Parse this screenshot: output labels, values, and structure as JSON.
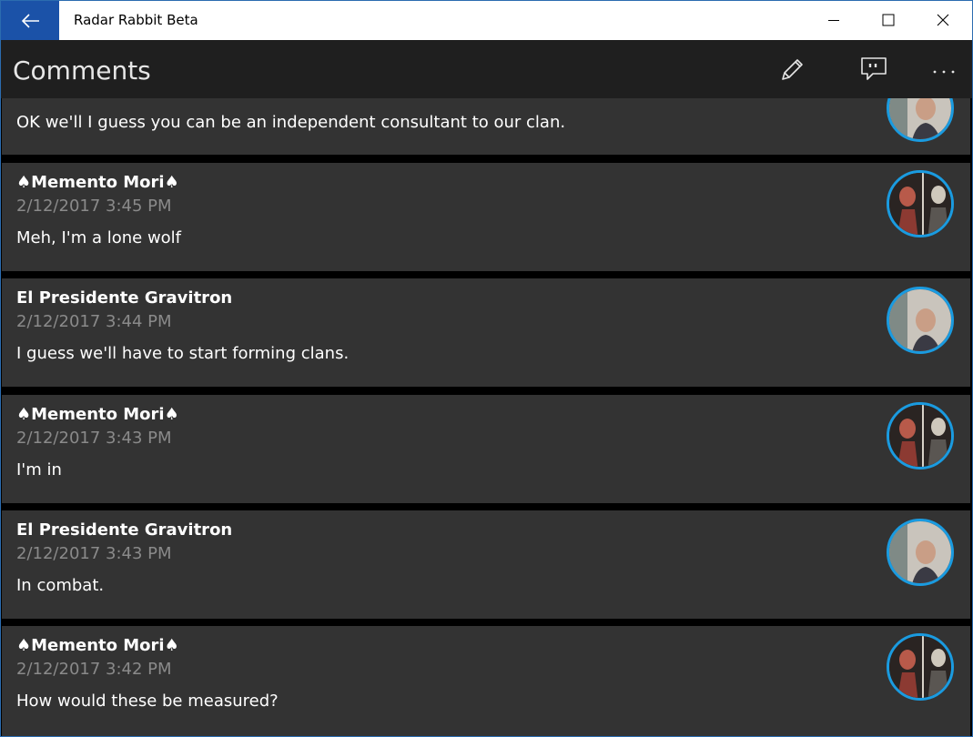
{
  "window": {
    "title": "Radar Rabbit Beta"
  },
  "header": {
    "page_title": "Comments"
  },
  "comments": [
    {
      "author": "",
      "timestamp": "",
      "message": "OK we'll I guess you can be an independent consultant to our clan.",
      "avatar": "el-presidente"
    },
    {
      "author": "♠Memento Mori♠",
      "timestamp": "2/12/2017 3:45 PM",
      "message": "Meh, I'm a lone wolf",
      "avatar": "memento-mori"
    },
    {
      "author": "El Presidente Gravitron",
      "timestamp": "2/12/2017 3:44 PM",
      "message": "I guess we'll have to start forming clans.",
      "avatar": "el-presidente"
    },
    {
      "author": "♠Memento Mori♠",
      "timestamp": "2/12/2017 3:43 PM",
      "message": "I'm in",
      "avatar": "memento-mori"
    },
    {
      "author": "El Presidente Gravitron",
      "timestamp": "2/12/2017 3:43 PM",
      "message": "In combat.",
      "avatar": "el-presidente"
    },
    {
      "author": "♠Memento Mori♠",
      "timestamp": "2/12/2017 3:42 PM",
      "message": "How would these be measured?",
      "avatar": "memento-mori"
    }
  ],
  "colors": {
    "accent": "#1b52a8",
    "avatar_ring": "#1a9be0",
    "card_bg": "#333333",
    "command_bar_bg": "#1f1f1f",
    "timestamp_gray": "#8a8a8a"
  },
  "icons": {
    "back": "arrow-left-icon",
    "minimize": "minimize-icon",
    "maximize": "maximize-icon",
    "close": "close-icon",
    "edit": "pencil-icon",
    "comment": "comment-bubble-icon",
    "more": "more-ellipsis-icon"
  }
}
